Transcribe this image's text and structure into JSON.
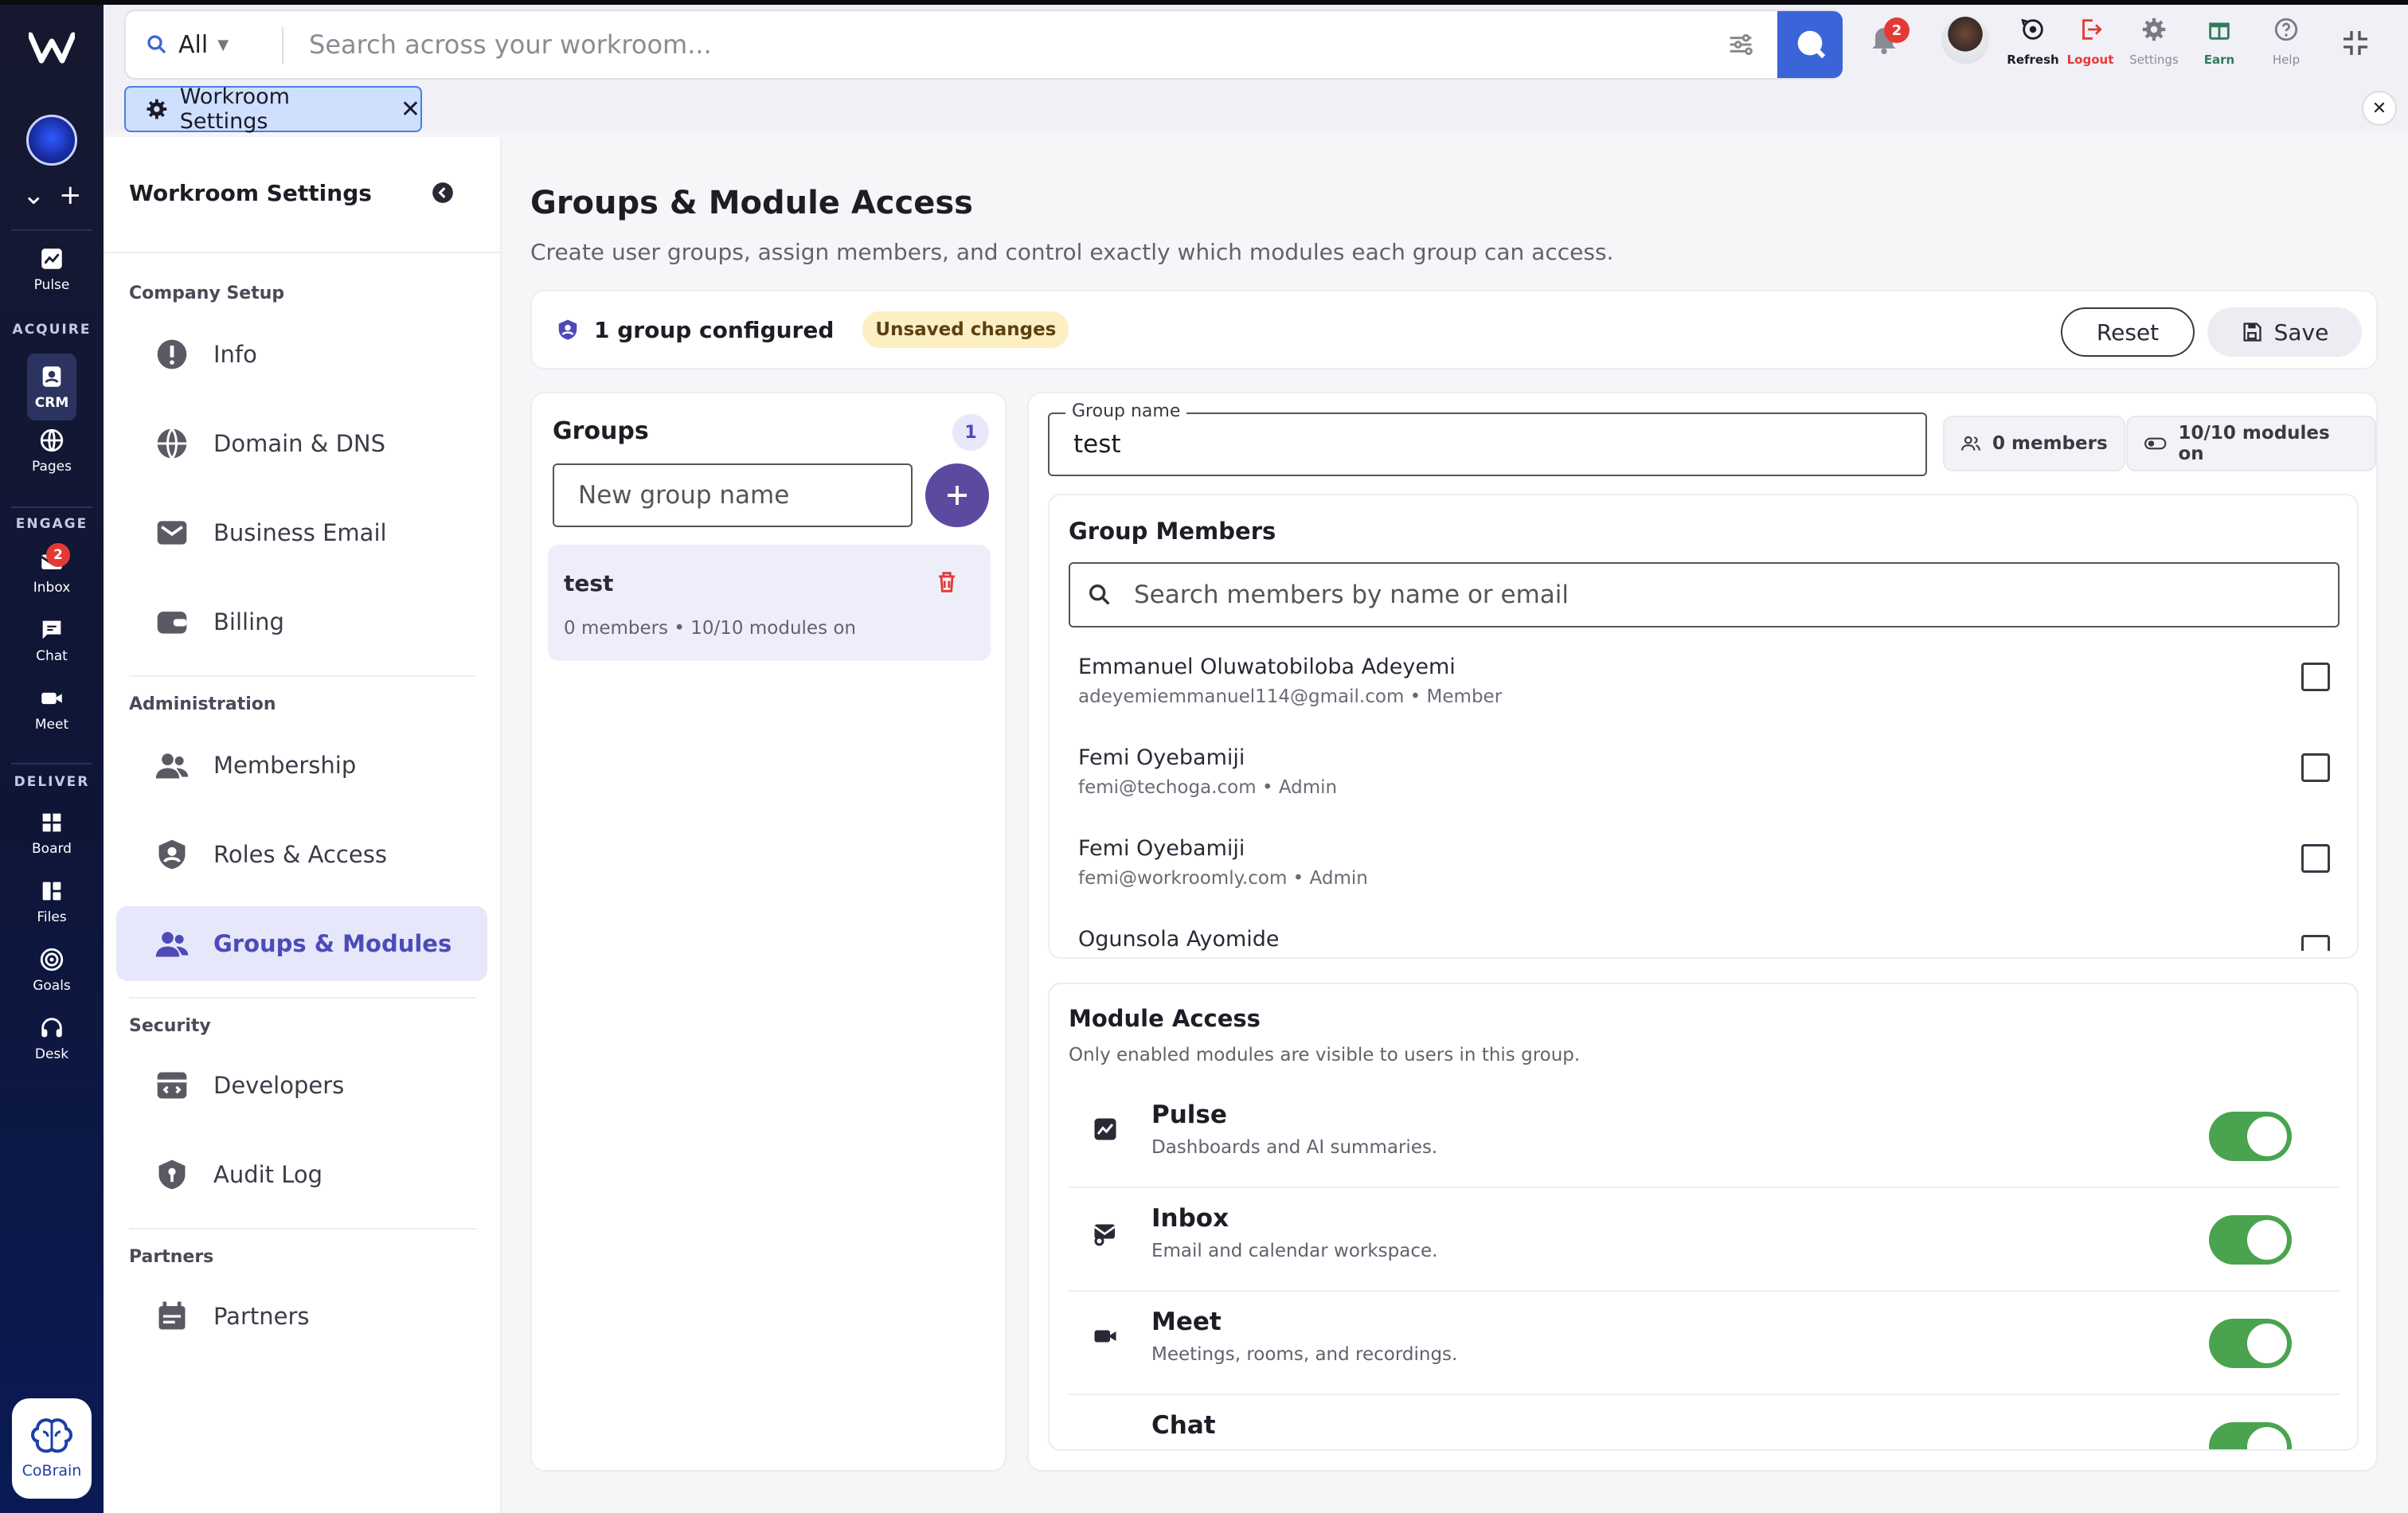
{
  "topbar": {
    "scope": "All",
    "search_placeholder": "Search across your workroom...",
    "notifications": "2",
    "actions": [
      {
        "label": "Refresh",
        "color": "#1d1d26"
      },
      {
        "label": "Logout",
        "color": "#e53935"
      },
      {
        "label": "Settings",
        "color": "#8b8b95"
      },
      {
        "label": "Earn",
        "color": "#2e7d5b"
      },
      {
        "label": "Help",
        "color": "#8b8b95"
      }
    ]
  },
  "tab": {
    "label": "Workroom Settings"
  },
  "rail": {
    "sections": [
      "ACQUIRE",
      "ENGAGE",
      "DELIVER"
    ],
    "items": {
      "pulse": "Pulse",
      "crm": "CRM",
      "pages": "Pages",
      "inbox": "Inbox",
      "inbox_badge": "2",
      "chat": "Chat",
      "meet": "Meet",
      "board": "Board",
      "files": "Files",
      "goals": "Goals",
      "desk": "Desk"
    },
    "cobrain": "CoBrain"
  },
  "settings_nav": {
    "title": "Workroom Settings",
    "groups": {
      "company": "Company Setup",
      "admin": "Administration",
      "security": "Security",
      "partners": "Partners"
    },
    "items": {
      "info": "Info",
      "domain": "Domain & DNS",
      "email": "Business Email",
      "billing": "Billing",
      "membership": "Membership",
      "roles": "Roles & Access",
      "groups": "Groups & Modules",
      "developers": "Developers",
      "audit": "Audit Log",
      "partners": "Partners"
    }
  },
  "page": {
    "title": "Groups & Module Access",
    "subtitle": "Create user groups, assign members, and control exactly which modules each group can access."
  },
  "status": {
    "configured": "1 group configured",
    "unsaved": "Unsaved changes",
    "reset": "Reset",
    "save": "Save"
  },
  "groups_panel": {
    "title": "Groups",
    "count": "1",
    "new_placeholder": "New group name",
    "list": [
      {
        "name": "test",
        "meta": "0 members • 10/10 modules on"
      }
    ]
  },
  "group_detail": {
    "name_label": "Group name",
    "name_value": "test",
    "members_pill": "0 members",
    "modules_pill": "10/10 modules on",
    "members_title": "Group Members",
    "members_search_placeholder": "Search members by name or email",
    "members": [
      {
        "name": "Emmanuel Oluwatobiloba Adeyemi",
        "email": "adeyemiemmanuel114@gmail.com • Member",
        "checked": false
      },
      {
        "name": "Femi Oyebamiji",
        "email": "femi@techoga.com • Admin",
        "checked": false
      },
      {
        "name": "Femi Oyebamiji",
        "email": "femi@workroomly.com • Admin",
        "checked": false
      },
      {
        "name": "Ogunsola Ayomide",
        "email": "",
        "checked": false
      }
    ],
    "modules_title": "Module Access",
    "modules_subtitle": "Only enabled modules are visible to users in this group.",
    "modules": [
      {
        "name": "Pulse",
        "desc": "Dashboards and AI summaries.",
        "enabled": true
      },
      {
        "name": "Inbox",
        "desc": "Email and calendar workspace.",
        "enabled": true
      },
      {
        "name": "Meet",
        "desc": "Meetings, rooms, and recordings.",
        "enabled": true
      },
      {
        "name": "Chat",
        "desc": "",
        "enabled": true
      }
    ],
    "toggle_on_color": "#4aa34e"
  }
}
